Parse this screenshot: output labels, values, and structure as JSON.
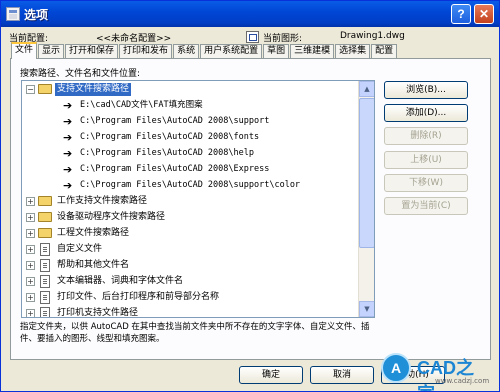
{
  "window": {
    "title": "选项",
    "help_label": "?",
    "close_label": "✕"
  },
  "profile": {
    "current_config_label": "当前配置:",
    "current_config_value": "<<未命名配置>>",
    "current_drawing_label": "当前图形:",
    "current_drawing_value": "Drawing1.dwg"
  },
  "tabs": [
    {
      "label": "文件",
      "active": true
    },
    {
      "label": "显示"
    },
    {
      "label": "打开和保存"
    },
    {
      "label": "打印和发布"
    },
    {
      "label": "系统"
    },
    {
      "label": "用户系统配置"
    },
    {
      "label": "草图"
    },
    {
      "label": "三维建模"
    },
    {
      "label": "选择集"
    },
    {
      "label": "配置"
    }
  ],
  "file_panel": {
    "search_label": "搜索路径、文件名和文件位置:",
    "tree": [
      {
        "type": "folder",
        "label": "支持文件搜索路径",
        "expanded": true,
        "selected": true
      },
      {
        "type": "path",
        "label": "E:\\cad\\CAD文件\\FAT填充图案"
      },
      {
        "type": "path",
        "label": "C:\\Program Files\\AutoCAD 2008\\support"
      },
      {
        "type": "path",
        "label": "C:\\Program Files\\AutoCAD 2008\\fonts"
      },
      {
        "type": "path",
        "label": "C:\\Program Files\\AutoCAD 2008\\help"
      },
      {
        "type": "path",
        "label": "C:\\Program Files\\AutoCAD 2008\\Express"
      },
      {
        "type": "path",
        "label": "C:\\Program Files\\AutoCAD 2008\\support\\color"
      },
      {
        "type": "folder",
        "label": "工作支持文件搜索路径"
      },
      {
        "type": "folder",
        "label": "设备驱动程序文件搜索路径"
      },
      {
        "type": "folder",
        "label": "工程文件搜索路径"
      },
      {
        "type": "doc",
        "label": "自定义文件"
      },
      {
        "type": "doc",
        "label": "帮助和其他文件名"
      },
      {
        "type": "doc",
        "label": "文本编辑器、词典和字体文件名"
      },
      {
        "type": "doc",
        "label": "打印文件、后台打印程序和前导部分名称"
      },
      {
        "type": "doc",
        "label": "打印机支持文件路径"
      }
    ],
    "description": "指定文件夹，以供 AutoCAD 在其中查找当前文件夹中所不存在的文字字体、自定义文件、插件、要插入的图形、线型和填充图案。"
  },
  "side_buttons": {
    "browse": "浏览(B)...",
    "add": "添加(D)...",
    "delete": "删除(R)",
    "move_up": "上移(U)",
    "move_down": "下移(W)",
    "set_current": "置为当前(C)"
  },
  "bottom_buttons": {
    "ok": "确定",
    "cancel": "取消",
    "help": "帮助(H)"
  },
  "watermark": {
    "circle_text": "A",
    "brand": "CAD之家",
    "url": "www.cadzj.com"
  },
  "colors": {
    "titlebar": "#0047d6",
    "selection": "#316ac5",
    "tab_highlight": "#ffc83c"
  }
}
